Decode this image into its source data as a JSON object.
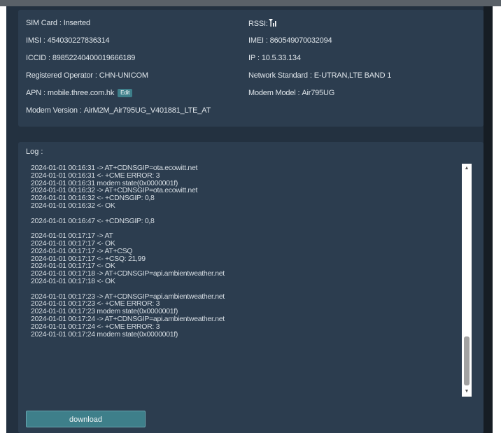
{
  "info": {
    "sim_card": {
      "label": "SIM Card",
      "value": "Inserted"
    },
    "rssi": {
      "label": "RSSI",
      "icon": "signal-strength-icon"
    },
    "imsi": {
      "label": "IMSI",
      "value": "454030227836314"
    },
    "imei": {
      "label": "IMEI",
      "value": "860549070032094"
    },
    "iccid": {
      "label": "ICCID",
      "value": "89852240400019666189"
    },
    "ip": {
      "label": "IP",
      "value": "10.5.33.134"
    },
    "registered_operator": {
      "label": "Registered Operator",
      "value": "CHN-UNICOM"
    },
    "network_standard": {
      "label": "Network Standard",
      "value": "E-UTRAN,LTE BAND 1"
    },
    "apn": {
      "label": "APN",
      "value": "mobile.three.com.hk",
      "edit_label": "Edit"
    },
    "modem_model": {
      "label": "Modem Model",
      "value": "Air795UG"
    },
    "modem_version": {
      "label": "Modem Version",
      "value": "AirM2M_Air795UG_V401881_LTE_AT"
    }
  },
  "log": {
    "label": "Log :",
    "text": "2024-01-01 00:16:31 -> AT+CDNSGIP=ota.ecowitt.net\n2024-01-01 00:16:31 <- +CME ERROR: 3\n2024-01-01 00:16:31 modem state(0x0000001f)\n2024-01-01 00:16:32 -> AT+CDNSGIP=ota.ecowitt.net\n2024-01-01 00:16:32 <- +CDNSGIP: 0,8\n2024-01-01 00:16:32 <- OK\n\n2024-01-01 00:16:47 <- +CDNSGIP: 0,8\n\n2024-01-01 00:17:17 -> AT\n2024-01-01 00:17:17 <- OK\n2024-01-01 00:17:17 -> AT+CSQ\n2024-01-01 00:17:17 <- +CSQ: 21,99\n2024-01-01 00:17:17 <- OK\n2024-01-01 00:17:18 -> AT+CDNSGIP=api.ambientweather.net\n2024-01-01 00:17:18 <- OK\n\n2024-01-01 00:17:23 -> AT+CDNSGIP=api.ambientweather.net\n2024-01-01 00:17:23 <- +CME ERROR: 3\n2024-01-01 00:17:23 modem state(0x0000001f)\n2024-01-01 00:17:24 -> AT+CDNSGIP=api.ambientweather.net\n2024-01-01 00:17:24 <- +CME ERROR: 3\n2024-01-01 00:17:24 modem state(0x0000001f)"
  },
  "download_label": "download",
  "colors": {
    "background": "#233140",
    "panel": "#2c3d4f",
    "accent": "#3e7f8a",
    "text": "#dfe5ea"
  }
}
